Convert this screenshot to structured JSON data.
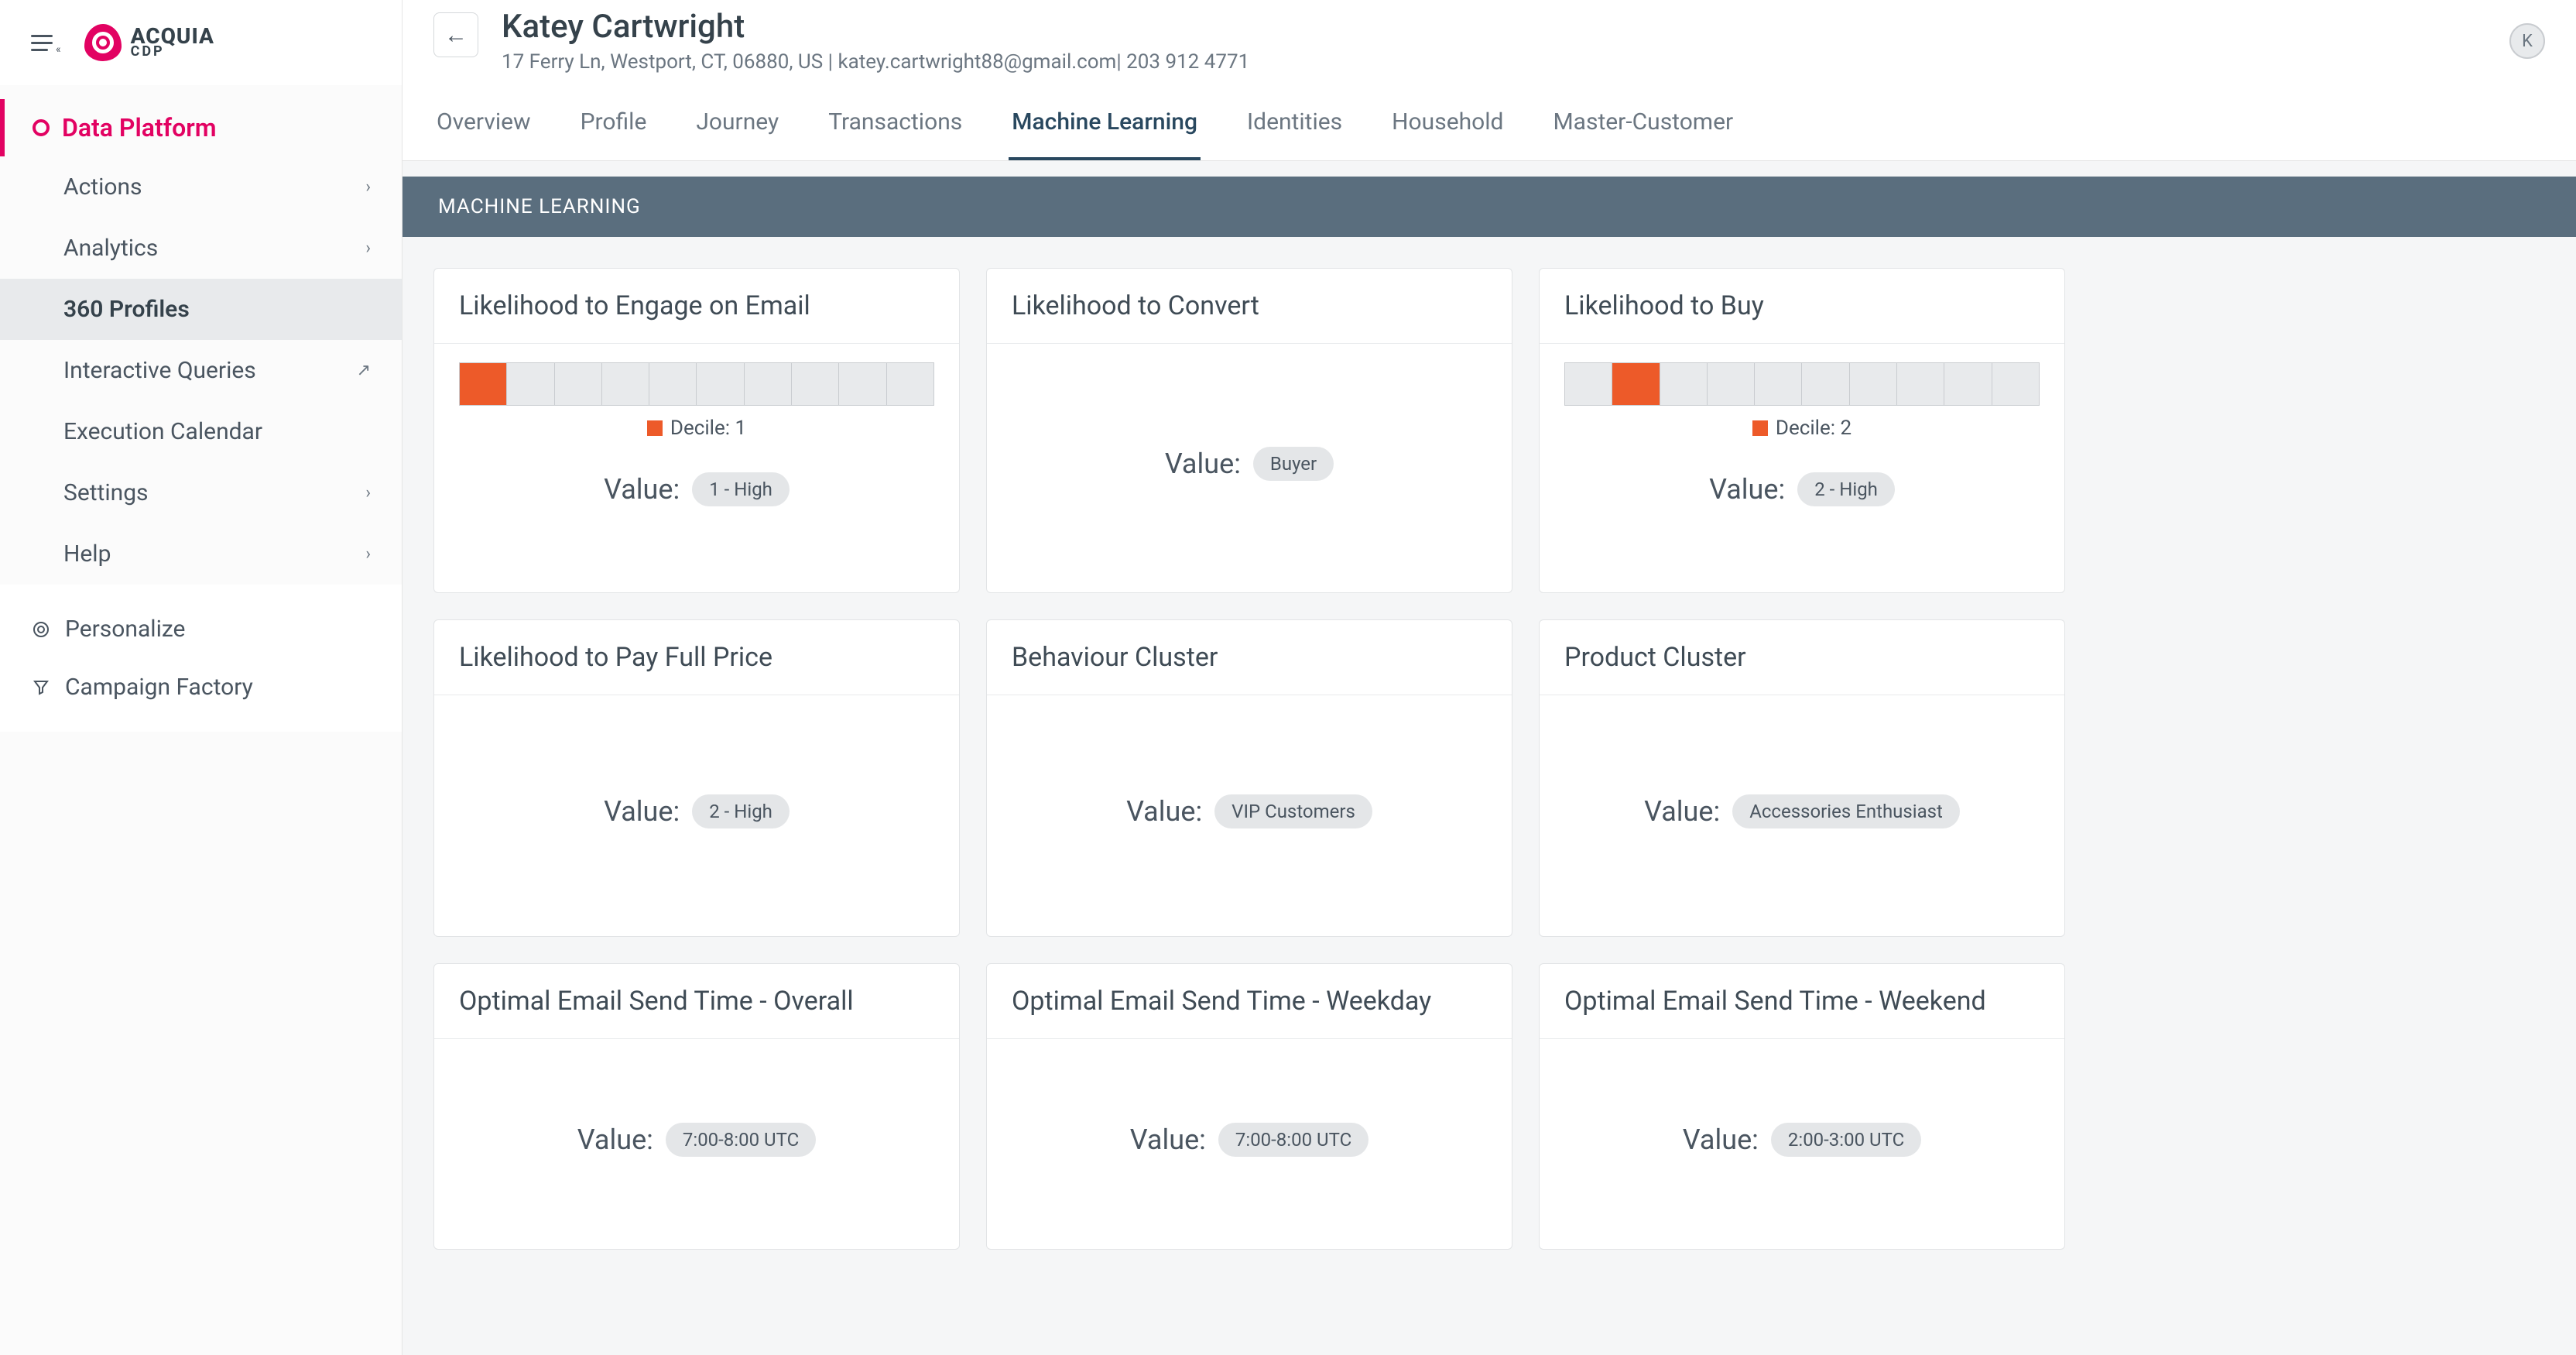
{
  "brand": {
    "name": "ACQUIA",
    "sub": "CDP"
  },
  "sidebar": {
    "header": "Data Platform",
    "items": [
      {
        "label": "Actions",
        "chevron": true
      },
      {
        "label": "Analytics",
        "chevron": true
      },
      {
        "label": "360 Profiles",
        "active": true
      },
      {
        "label": "Interactive Queries",
        "external": true
      },
      {
        "label": "Execution Calendar"
      },
      {
        "label": "Settings",
        "chevron": true
      },
      {
        "label": "Help",
        "chevron": true
      }
    ],
    "secondary": [
      {
        "label": "Personalize",
        "icon": "target"
      },
      {
        "label": "Campaign Factory",
        "icon": "funnel"
      }
    ]
  },
  "profile": {
    "name": "Katey Cartwright",
    "subline": "17 Ferry Ln, Westport, CT, 06880, US | katey.cartwright88@gmail.com| 203 912 4771",
    "avatar_initial": "K"
  },
  "tabs": [
    {
      "label": "Overview"
    },
    {
      "label": "Profile"
    },
    {
      "label": "Journey"
    },
    {
      "label": "Transactions"
    },
    {
      "label": "Machine Learning",
      "active": true
    },
    {
      "label": "Identities"
    },
    {
      "label": "Household"
    },
    {
      "label": "Master-Customer"
    }
  ],
  "section_band": "MACHINE LEARNING",
  "value_label": "Value:",
  "decile_label_prefix": "Decile: ",
  "cards": [
    {
      "title": "Likelihood to Engage on Email",
      "decile": 1,
      "value": "1 - High",
      "row": 1
    },
    {
      "title": "Likelihood to Convert",
      "value": "Buyer",
      "row": 1,
      "center": true
    },
    {
      "title": "Likelihood to Buy",
      "decile": 2,
      "value": "2 - High",
      "row": 1
    },
    {
      "title": "Likelihood to Pay Full Price",
      "value": "2 - High",
      "row": 2,
      "center": true
    },
    {
      "title": "Behaviour Cluster",
      "value": "VIP Customers",
      "row": 2,
      "center": true
    },
    {
      "title": "Product Cluster",
      "value": "Accessories Enthusiast",
      "row": 2,
      "center": true
    },
    {
      "title": "Optimal Email Send Time - Overall",
      "value": "7:00-8:00 UTC",
      "row": 3,
      "center": true
    },
    {
      "title": "Optimal Email Send Time - Weekday",
      "value": "7:00-8:00 UTC",
      "row": 3,
      "center": true
    },
    {
      "title": "Optimal Email Send Time - Weekend",
      "value": "2:00-3:00 UTC",
      "row": 3,
      "center": true
    }
  ]
}
